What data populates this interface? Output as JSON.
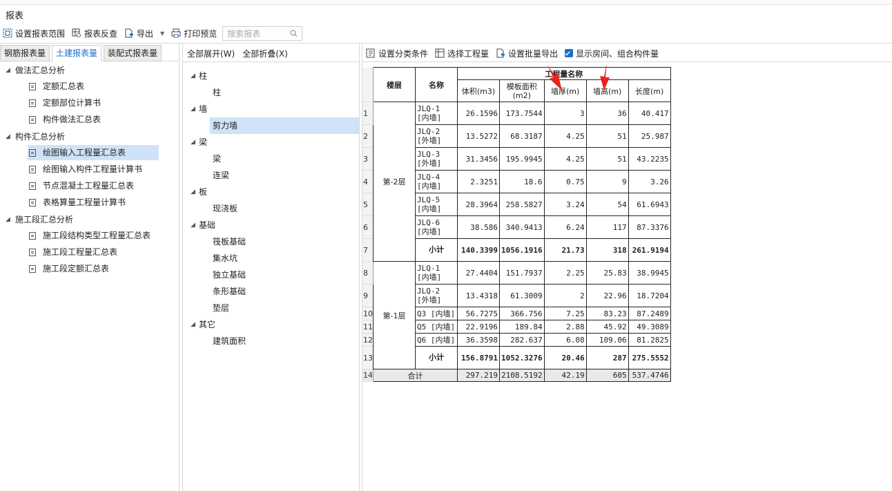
{
  "window": {
    "title": "报表"
  },
  "toolbar": {
    "set_range": "设置报表范围",
    "reverse": "报表反查",
    "export": "导出",
    "print_preview": "打印预览",
    "search_placeholder": "搜索报表"
  },
  "tabs": [
    "钢筋报表量",
    "土建报表量",
    "装配式报表量"
  ],
  "active_tab": 1,
  "tree": {
    "groups": [
      {
        "label": "做法汇总分析",
        "items": [
          "定额汇总表",
          "定额部位计算书",
          "构件做法汇总表"
        ]
      },
      {
        "label": "构件汇总分析",
        "items": [
          "绘图输入工程量汇总表",
          "绘图输入构件工程量计算书",
          "节点混凝土工程量汇总表",
          "表格算量工程量计算书"
        ]
      },
      {
        "label": "施工段汇总分析",
        "items": [
          "施工段结构类型工程量汇总表",
          "施工段工程量汇总表",
          "施工段定额汇总表"
        ]
      }
    ],
    "selected": "绘图输入工程量汇总表"
  },
  "mid": {
    "expand_all": "全部展开(W)",
    "collapse_all": "全部折叠(X)",
    "categories": [
      {
        "label": "柱",
        "items": [
          "柱"
        ]
      },
      {
        "label": "墙",
        "items": [
          "剪力墙"
        ]
      },
      {
        "label": "梁",
        "items": [
          "梁",
          "连梁"
        ]
      },
      {
        "label": "板",
        "items": [
          "现浇板"
        ]
      },
      {
        "label": "基础",
        "items": [
          "筏板基础",
          "集水坑",
          "独立基础",
          "条形基础",
          "垫层"
        ]
      },
      {
        "label": "其它",
        "items": [
          "建筑面积"
        ]
      }
    ],
    "selected": "剪力墙"
  },
  "right_toolbar": {
    "set_category": "设置分类条件",
    "select_qty": "选择工程量",
    "batch_export": "设置批量导出",
    "show_rooms": "显示房间、组合构件量"
  },
  "report": {
    "headers": {
      "floor": "楼层",
      "name": "名称",
      "group": "工程量名称",
      "cols": [
        "体积(m3)",
        "模板面积(m2)",
        "墙厚(m)",
        "墙高(m)",
        "长度(m)"
      ]
    },
    "floors": [
      {
        "floor": "第-2层",
        "rows": [
          {
            "rn": "1",
            "name": "JLQ-1 [内墙]",
            "v": [
              "26.1596",
              "173.7544",
              "3",
              "36",
              "40.417"
            ]
          },
          {
            "rn": "2",
            "name": "JLQ-2 [外墙]",
            "v": [
              "13.5272",
              "68.3187",
              "4.25",
              "51",
              "25.987"
            ]
          },
          {
            "rn": "3",
            "name": "JLQ-3 [外墙]",
            "v": [
              "31.3456",
              "195.9945",
              "4.25",
              "51",
              "43.2235"
            ]
          },
          {
            "rn": "4",
            "name": "JLQ-4 [内墙]",
            "v": [
              "2.3251",
              "18.6",
              "0.75",
              "9",
              "3.26"
            ]
          },
          {
            "rn": "5",
            "name": "JLQ-5 [内墙]",
            "v": [
              "28.3964",
              "258.5827",
              "3.24",
              "54",
              "61.6943"
            ]
          },
          {
            "rn": "6",
            "name": "JLQ-6 [内墙]",
            "v": [
              "38.586",
              "340.9413",
              "6.24",
              "117",
              "87.3376"
            ]
          }
        ],
        "subtotal": {
          "rn": "7",
          "label": "小计",
          "v": [
            "140.3399",
            "1056.1916",
            "21.73",
            "318",
            "261.9194"
          ]
        }
      },
      {
        "floor": "第-1层",
        "rows": [
          {
            "rn": "8",
            "name": "JLQ-1 [内墙]",
            "v": [
              "27.4404",
              "151.7937",
              "2.25",
              "25.83",
              "38.9945"
            ]
          },
          {
            "rn": "9",
            "name": "JLQ-2 [外墙]",
            "v": [
              "13.4318",
              "61.3009",
              "2",
              "22.96",
              "18.7204"
            ]
          },
          {
            "rn": "10",
            "name": "Q3 [内墙]",
            "v": [
              "56.7275",
              "366.756",
              "7.25",
              "83.23",
              "87.2489"
            ]
          },
          {
            "rn": "11",
            "name": "Q5 [内墙]",
            "v": [
              "22.9196",
              "189.84",
              "2.88",
              "45.92",
              "49.3089"
            ]
          },
          {
            "rn": "12",
            "name": "Q6 [内墙]",
            "v": [
              "36.3598",
              "282.637",
              "6.08",
              "109.06",
              "81.2825"
            ]
          }
        ],
        "subtotal": {
          "rn": "13",
          "label": "小计",
          "v": [
            "156.8791",
            "1052.3276",
            "20.46",
            "287",
            "275.5552"
          ]
        }
      }
    ],
    "total": {
      "rn": "14",
      "label": "合计",
      "v": [
        "297.219",
        "2108.5192",
        "42.19",
        "605",
        "537.4746"
      ]
    }
  },
  "colors": {
    "accent": "#1b6fd0",
    "selection": "#cfe2f7",
    "annotation": "#e8231f"
  }
}
